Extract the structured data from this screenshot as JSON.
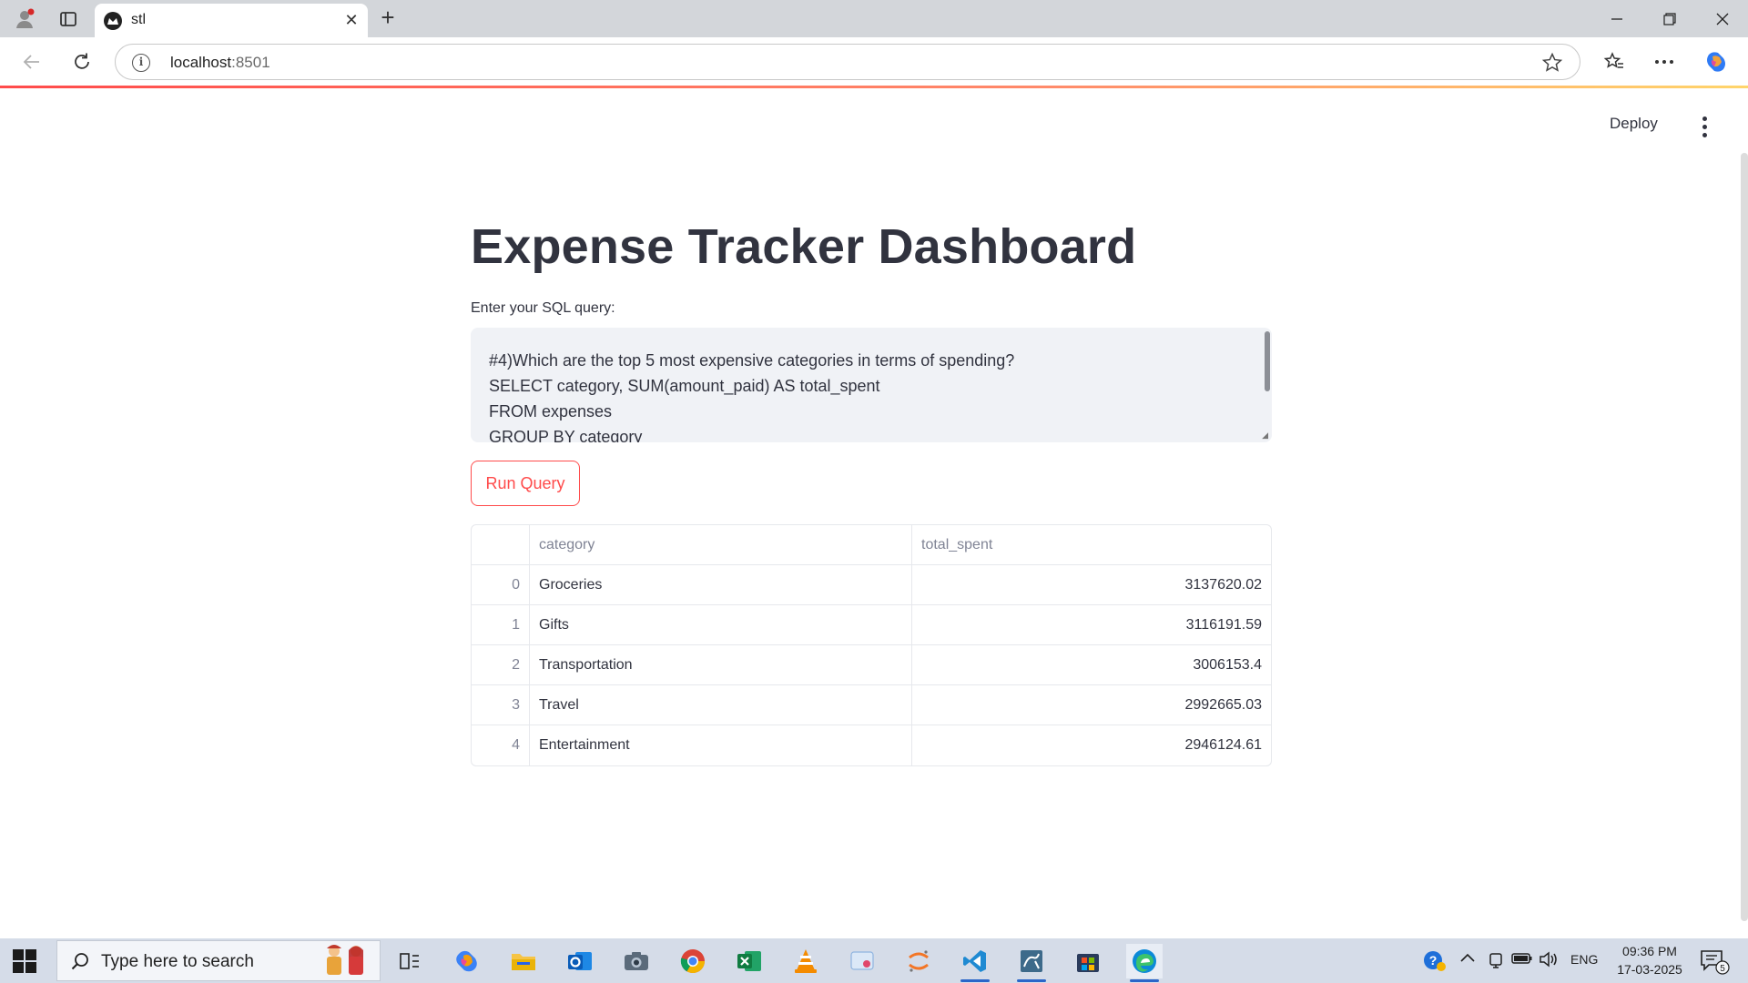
{
  "browser": {
    "tab_title": "stl",
    "address_host": "localhost",
    "address_port": ":8501"
  },
  "app": {
    "deploy_label": "Deploy",
    "title": "Expense Tracker Dashboard",
    "sql_label": "Enter your SQL query:",
    "sql_query": "#4)Which are the top 5 most expensive categories in terms of spending?\nSELECT category, SUM(amount_paid) AS total_spent\nFROM expenses\nGROUP BY category",
    "run_button": "Run Query",
    "accent_color": "#ff4b4b",
    "table": {
      "columns": [
        "category",
        "total_spent"
      ],
      "rows": [
        {
          "index": "0",
          "category": "Groceries",
          "total_spent": "3137620.02"
        },
        {
          "index": "1",
          "category": "Gifts",
          "total_spent": "3116191.59"
        },
        {
          "index": "2",
          "category": "Transportation",
          "total_spent": "3006153.4"
        },
        {
          "index": "3",
          "category": "Travel",
          "total_spent": "2992665.03"
        },
        {
          "index": "4",
          "category": "Entertainment",
          "total_spent": "2946124.61"
        }
      ]
    }
  },
  "taskbar": {
    "search_placeholder": "Type here to search",
    "language": "ENG",
    "time": "09:36 PM",
    "date": "17-03-2025",
    "notification_count": "5",
    "apps": [
      "copilot-icon",
      "file-explorer-icon",
      "outlook-icon",
      "camera-icon",
      "chrome-icon",
      "excel-icon",
      "vlc-icon",
      "snipping-tool-icon",
      "jupyter-icon",
      "vscode-icon",
      "mysql-workbench-icon",
      "store-icon",
      "edge-icon"
    ]
  }
}
